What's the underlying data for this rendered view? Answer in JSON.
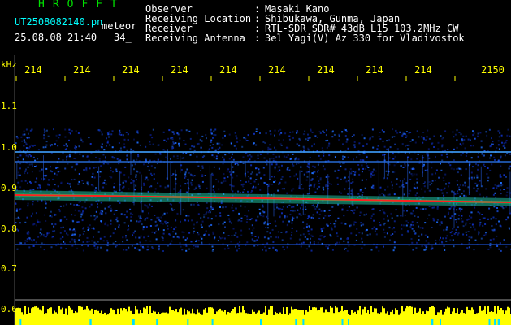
{
  "header": {
    "app_title": "HROFFT",
    "file_name": "UT2508082140.pn",
    "mode": "meteor",
    "date_time": "25.08.08 21:40",
    "count": "34_"
  },
  "info": [
    {
      "label": "Observer",
      "value": "Masaki Kano"
    },
    {
      "label": "Receiving Location",
      "value": "Shibukawa, Gunma, Japan"
    },
    {
      "label": "Receiver",
      "value": "RTL-SDR SDR# 43dB L15 103.2MHz CW"
    },
    {
      "label": "Receiving Antenna",
      "value": "3el Yagi(V) Az 330 for Vladivostok"
    }
  ],
  "axis": {
    "unit_label": "kHz",
    "time_labels": [
      "214",
      "214",
      "214",
      "214",
      "214",
      "214",
      "214",
      "214",
      "214",
      "2150"
    ],
    "freq_labels": [
      "1.1",
      "1.0",
      "0.9",
      "0.8",
      "0.7",
      "0.6"
    ]
  },
  "colors": {
    "text": "#ffffff",
    "title": "#00e000",
    "filename": "#00ffff",
    "axis": "#ffff00",
    "signal": "#ff2020",
    "noise": "#1030c0",
    "histogram": "#ffff00"
  }
}
